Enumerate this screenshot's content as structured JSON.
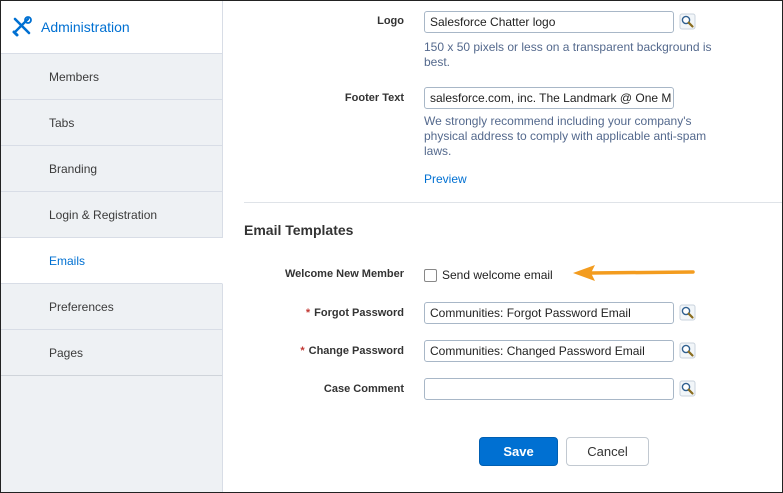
{
  "sidebar": {
    "header": {
      "title": "Administration",
      "icon": "tools-icon"
    },
    "items": [
      {
        "label": "Members",
        "active": false
      },
      {
        "label": "Tabs",
        "active": false
      },
      {
        "label": "Branding",
        "active": false
      },
      {
        "label": "Login & Registration",
        "active": false
      },
      {
        "label": "Emails",
        "active": true
      },
      {
        "label": "Preferences",
        "active": false
      },
      {
        "label": "Pages",
        "active": false
      }
    ]
  },
  "main": {
    "logo": {
      "label": "Logo",
      "value": "Salesforce Chatter logo",
      "hint": "150 x 50 pixels or less on a transparent background is best."
    },
    "footer_text": {
      "label": "Footer Text",
      "value": "salesforce.com, inc. The Landmark @ One M",
      "hint": "We strongly recommend including your company's physical address to comply with applicable anti-spam laws.",
      "preview_label": "Preview"
    },
    "email_templates": {
      "title": "Email Templates",
      "welcome": {
        "label": "Welcome New Member",
        "checkbox_label": "Send welcome email",
        "checked": false
      },
      "forgot_password": {
        "required_mark": "*",
        "label": "Forgot Password",
        "value": "Communities: Forgot Password Email"
      },
      "change_password": {
        "required_mark": "*",
        "label": "Change Password",
        "value": "Communities: Changed Password Email"
      },
      "case_comment": {
        "label": "Case Comment",
        "value": ""
      }
    },
    "buttons": {
      "save": "Save",
      "cancel": "Cancel"
    }
  },
  "colors": {
    "accent": "#0070d2",
    "required": "#c23934",
    "annotation_arrow": "#f39c1f",
    "sidebar_bg": "#eef1f4"
  }
}
